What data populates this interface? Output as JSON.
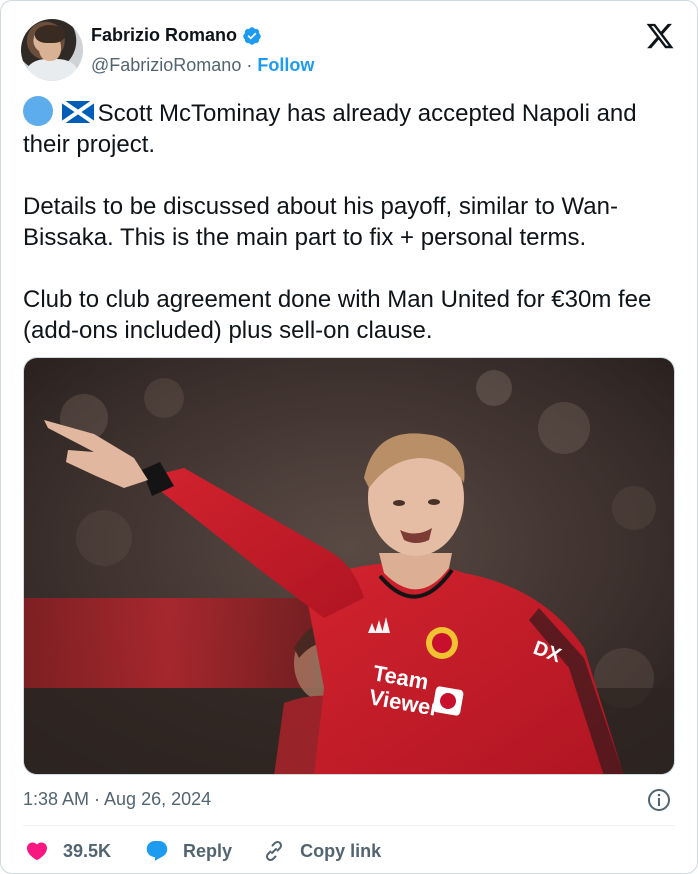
{
  "author": {
    "name": "Fabrizio Romano",
    "handle": "@FabrizioRomano",
    "separator": "·",
    "follow_label": "Follow"
  },
  "tweet": {
    "line1": "Scott McTominay has already accepted Napoli and their project.",
    "line2": "Details to be discussed about his payoff, similar to Wan-Bissaka. This is the main part to fix + personal terms.",
    "line3": "Club to club agreement done with Man United for €30m fee (add-ons included) plus sell-on clause.",
    "emojis": [
      "blue-circle-emoji",
      "scotland-flag-emoji"
    ]
  },
  "media": {
    "description_icon": "photo",
    "sponsor_text": "Team Viewer",
    "sleeve_text": "DX"
  },
  "meta": {
    "timestamp": "1:38 AM · Aug 26, 2024"
  },
  "actions": {
    "likes": "39.5K",
    "reply_label": "Reply",
    "copy_link_label": "Copy link"
  },
  "colors": {
    "accent": "#1d9bf0",
    "like": "#f91880",
    "secondary_text": "#536471",
    "jersey": "#c8102e"
  }
}
